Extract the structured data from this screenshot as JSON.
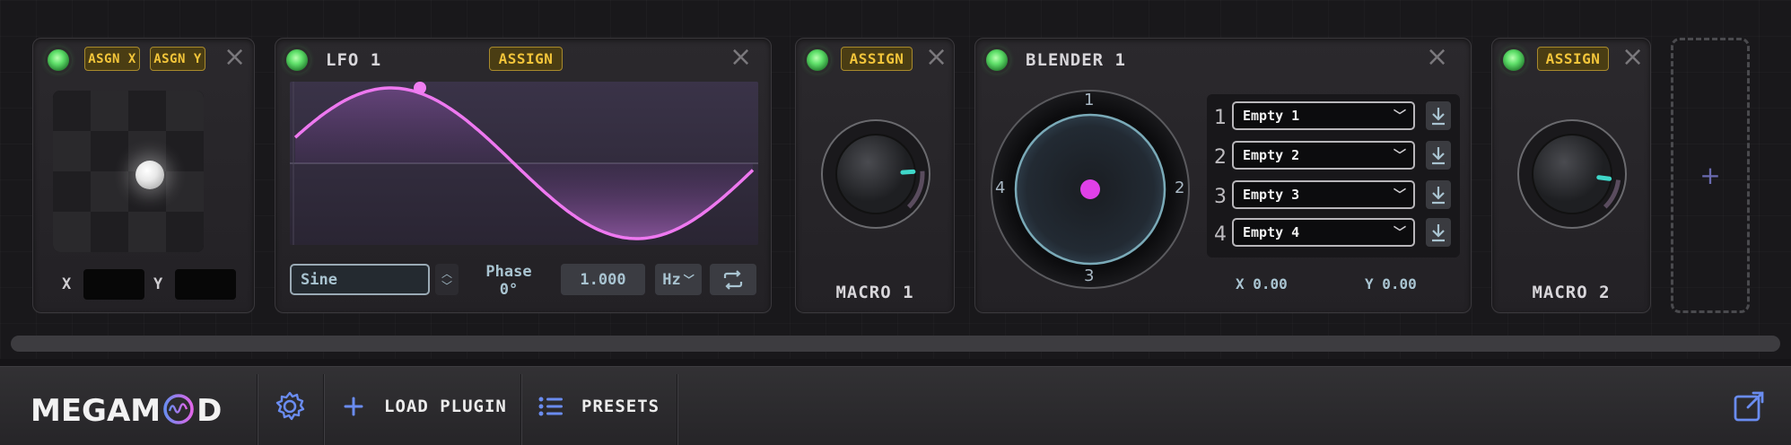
{
  "colors": {
    "assign_bg": "#4a3d13",
    "assign_text": "#f3c53a",
    "led_on": "#5fe06a",
    "lfo_wave": "#ee78f0",
    "blender_dot": "#e040e8",
    "accent_blue": "#6a8cf0",
    "knob_indicator": "#3fd7c9"
  },
  "xy_module": {
    "assign_x": "ASGN X",
    "assign_y": "ASGN Y",
    "x_label": "X",
    "y_label": "Y",
    "x_value": "",
    "y_value": ""
  },
  "lfo": {
    "title": "LFO 1",
    "assign": "ASSIGN",
    "shape": "Sine",
    "phase_label": "Phase",
    "phase_value": "0°",
    "rate": "1.000",
    "rate_unit": "Hz"
  },
  "macro1": {
    "assign": "ASSIGN",
    "label": "MACRO 1",
    "value": 0.82
  },
  "blender": {
    "title": "BLENDER 1",
    "ring_labels": [
      "1",
      "2",
      "3",
      "4"
    ],
    "slots": [
      {
        "num": "1",
        "value": "Empty 1"
      },
      {
        "num": "2",
        "value": "Empty 2"
      },
      {
        "num": "3",
        "value": "Empty 3"
      },
      {
        "num": "4",
        "value": "Empty 4"
      }
    ],
    "x_coord": "X 0.00",
    "y_coord": "Y 0.00"
  },
  "macro2": {
    "assign": "ASSIGN",
    "label": "MACRO 2",
    "value": 0.86
  },
  "add_module": "+",
  "bottom_bar": {
    "logo": "MEGAMOD",
    "load_plugin": "LOAD PLUGIN",
    "presets": "PRESETS",
    "icons": {
      "settings": "gear-icon",
      "load": "plus-icon",
      "presets": "list-icon",
      "popout": "external-window-icon"
    }
  }
}
